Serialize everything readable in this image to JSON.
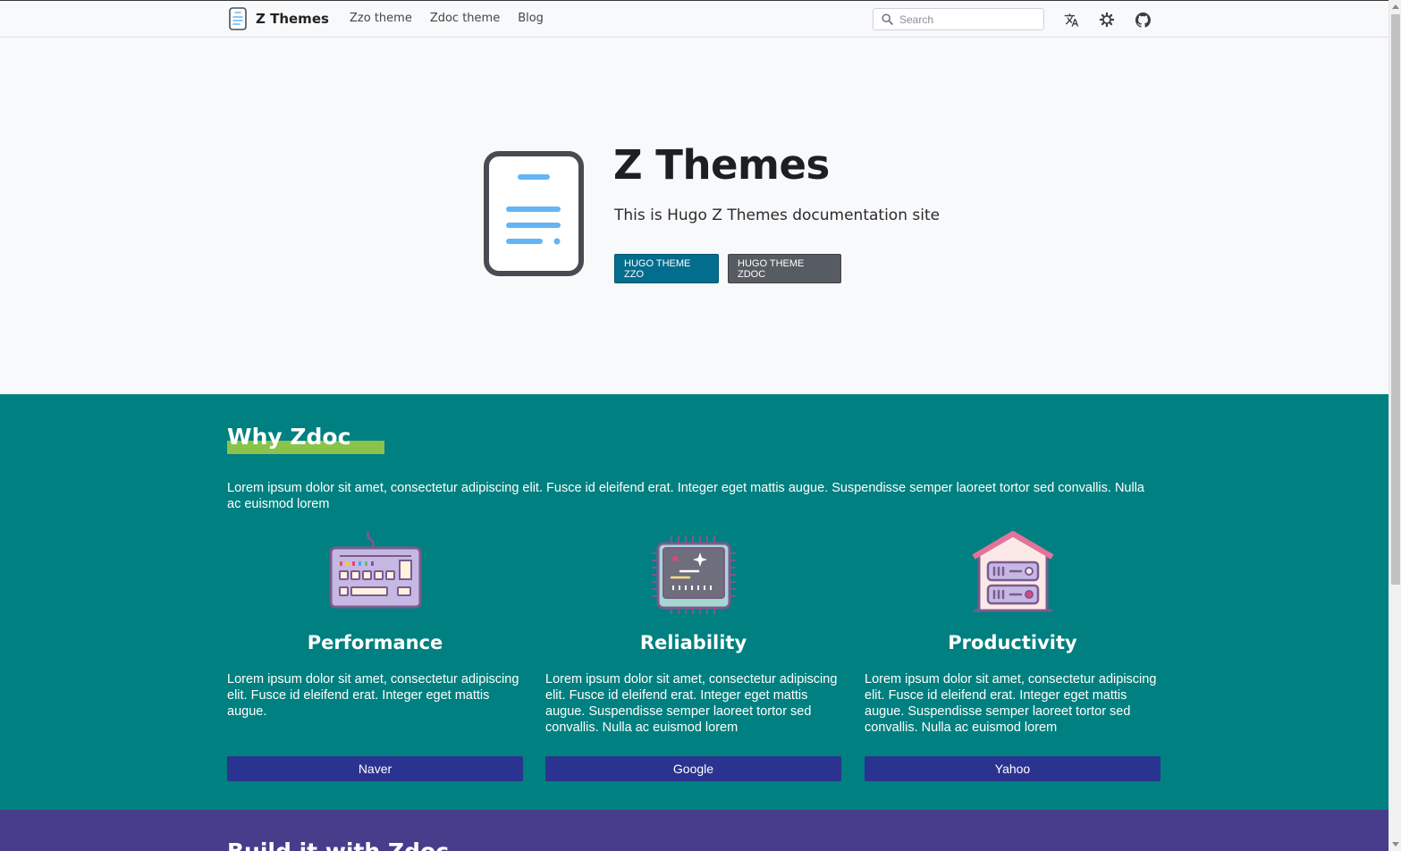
{
  "navbar": {
    "brand": "Z Themes",
    "links": [
      "Zzo theme",
      "Zdoc theme",
      "Blog"
    ],
    "search_placeholder": "Search",
    "icons": [
      "translate-icon",
      "theme-gear-icon",
      "github-icon"
    ]
  },
  "hero": {
    "title": "Z Themes",
    "subtitle": "This is Hugo Z Themes documentation site",
    "buttons": [
      "HUGO THEME ZZO",
      "HUGO THEME ZDOC"
    ]
  },
  "why": {
    "title": "Why Zdoc",
    "description": "Lorem ipsum dolor sit amet, consectetur adipiscing elit. Fusce id eleifend erat. Integer eget mattis augue. Suspendisse semper laoreet tortor sed convallis. Nulla ac euismod lorem",
    "features": [
      {
        "icon": "keyboard-icon",
        "title": "Performance",
        "text": "Lorem ipsum dolor sit amet, consectetur adipiscing elit. Fusce id eleifend erat. Integer eget mattis augue.",
        "button": "Naver"
      },
      {
        "icon": "chip-icon",
        "title": "Reliability",
        "text": "Lorem ipsum dolor sit amet, consectetur adipiscing elit. Fusce id eleifend erat. Integer eget mattis augue. Suspendisse semper laoreet tortor sed convallis. Nulla ac euismod lorem",
        "button": "Google"
      },
      {
        "icon": "server-house-icon",
        "title": "Productivity",
        "text": "Lorem ipsum dolor sit amet, consectetur adipiscing elit. Fusce id eleifend erat. Integer eget mattis augue. Suspendisse semper laoreet tortor sed convallis. Nulla ac euismod lorem",
        "button": "Yahoo"
      }
    ]
  },
  "build": {
    "title": "Build it with Zdoc"
  },
  "colors": {
    "teal_section": "#008080",
    "purple_section": "#483d8b",
    "accent_green": "#8bc34a",
    "feature_button": "#2b3390",
    "zzo_button": "#036d8e",
    "zdoc_button": "#575b62"
  }
}
